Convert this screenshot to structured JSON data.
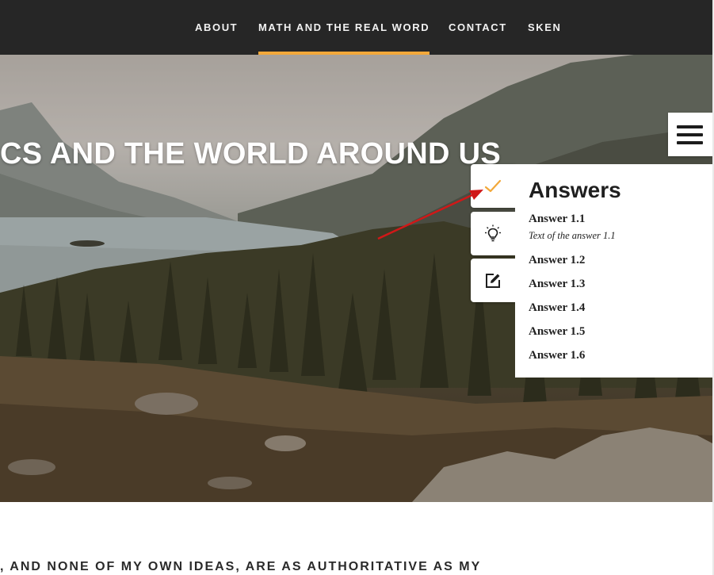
{
  "nav": {
    "items": [
      {
        "label": "ABOUT"
      },
      {
        "label": "MATH AND THE REAL WORD",
        "active": true
      },
      {
        "label": "CONTACT"
      },
      {
        "label": "SKEN"
      }
    ],
    "accent_color": "#f2a83a"
  },
  "hero": {
    "title": "CS AND THE WORLD AROUND US"
  },
  "tools": {
    "icons": [
      "check-icon",
      "lightbulb-icon",
      "edit-icon"
    ]
  },
  "answers": {
    "title": "Answers",
    "items": [
      {
        "label": "Answer 1.1",
        "text": "Text of the answer 1.1"
      },
      {
        "label": "Answer 1.2"
      },
      {
        "label": "Answer 1.3"
      },
      {
        "label": "Answer 1.4"
      },
      {
        "label": "Answer 1.5"
      },
      {
        "label": "Answer 1.6"
      }
    ]
  },
  "body": {
    "text": ", AND NONE OF MY OWN IDEAS, ARE AS AUTHORITATIVE AS MY"
  }
}
